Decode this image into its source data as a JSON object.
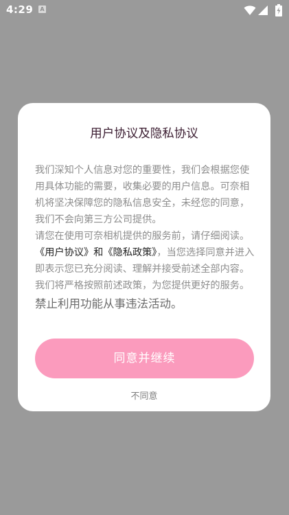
{
  "status_bar": {
    "time": "4:29",
    "notification_icon_letter": "A",
    "icons": [
      "notification-a-icon",
      "wifi-icon",
      "cellular-signal-icon",
      "battery-charging-icon"
    ]
  },
  "dialog": {
    "title": "用户协议及隐私协议",
    "paragraph1": "我们深知个人信息对您的重要性，我们会根据您使用具体功能的需要，收集必要的用户信息。可奈相机将坚决保障您的隐私信息安全，未经您的同意，我们不会向第三方公司提供。",
    "paragraph2_prefix": "请您在使用可奈相机提供的服务前，请仔细阅读。",
    "user_agreement_link": "《用户协议》",
    "and_text": "和",
    "privacy_policy_link": "《隐私政策》",
    "paragraph2_suffix": "，当您选择同意并进入即表示您已充分阅读、理解并接受前述全部内容。我们将严格按照前述政策，为您提供更好的服务。",
    "paragraph3": "禁止利用功能从事违法活动。",
    "agree_button": "同意并继续",
    "disagree_link": "不同意"
  },
  "colors": {
    "overlay": "#9a9a9a",
    "agree_button": "#fb9bbd",
    "title": "#3c1e32"
  }
}
